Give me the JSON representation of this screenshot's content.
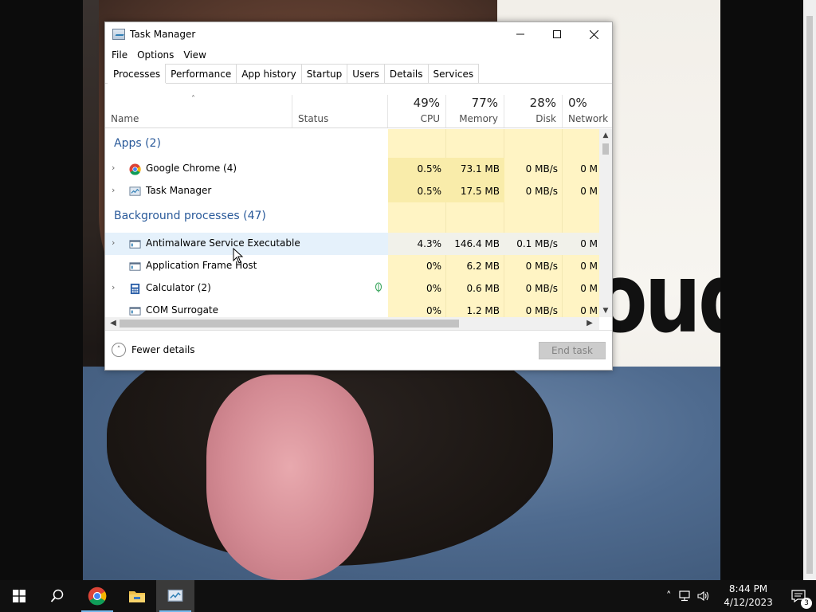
{
  "window": {
    "title": "Task Manager",
    "controls": {
      "minimize": "minimize-icon",
      "maximize": "maximize-icon",
      "close": "close-icon"
    }
  },
  "menu": [
    "File",
    "Options",
    "View"
  ],
  "tabs": [
    "Processes",
    "Performance",
    "App history",
    "Startup",
    "Users",
    "Details",
    "Services"
  ],
  "active_tab": "Processes",
  "columns": {
    "name": "Name",
    "status": "Status",
    "cpu": {
      "pct": "49%",
      "label": "CPU"
    },
    "memory": {
      "pct": "77%",
      "label": "Memory"
    },
    "disk": {
      "pct": "28%",
      "label": "Disk"
    },
    "network": {
      "pct": "0%",
      "label": "Network"
    }
  },
  "groups": {
    "apps": "Apps (2)",
    "background": "Background processes (47)"
  },
  "rows": [
    {
      "name": "Google Chrome (4)",
      "cpu": "0.5%",
      "memory": "73.1 MB",
      "disk": "0 MB/s",
      "network": "0 M",
      "icon": "chrome-icon",
      "expandable": true
    },
    {
      "name": "Task Manager",
      "cpu": "0.5%",
      "memory": "17.5 MB",
      "disk": "0 MB/s",
      "network": "0 M",
      "icon": "task-manager-icon",
      "expandable": true
    },
    {
      "name": "Antimalware Service Executable",
      "cpu": "4.3%",
      "memory": "146.4 MB",
      "disk": "0.1 MB/s",
      "network": "0 M",
      "icon": "service-icon",
      "expandable": true
    },
    {
      "name": "Application Frame Host",
      "cpu": "0%",
      "memory": "6.2 MB",
      "disk": "0 MB/s",
      "network": "0 M",
      "icon": "service-icon",
      "expandable": false
    },
    {
      "name": "Calculator (2)",
      "cpu": "0%",
      "memory": "0.6 MB",
      "disk": "0 MB/s",
      "network": "0 M",
      "icon": "calculator-icon",
      "expandable": true,
      "status_icon": "suspended-leaf-icon"
    },
    {
      "name": "COM Surrogate",
      "cpu": "0%",
      "memory": "1.2 MB",
      "disk": "0 MB/s",
      "network": "0 M",
      "icon": "service-icon",
      "expandable": false
    }
  ],
  "footer": {
    "fewer_details": "Fewer details",
    "end_task": "End task"
  },
  "wallpaper_text": "oud",
  "taskbar": {
    "time": "8:44 PM",
    "date": "4/12/2023",
    "notification_count": "3"
  },
  "colors": {
    "heat_light": "#fff4c4",
    "heat_mid": "#f9ecaa",
    "hover_row": "#e5f1fb",
    "group_blue": "#2a5a9a",
    "taskbar": "#101010"
  }
}
